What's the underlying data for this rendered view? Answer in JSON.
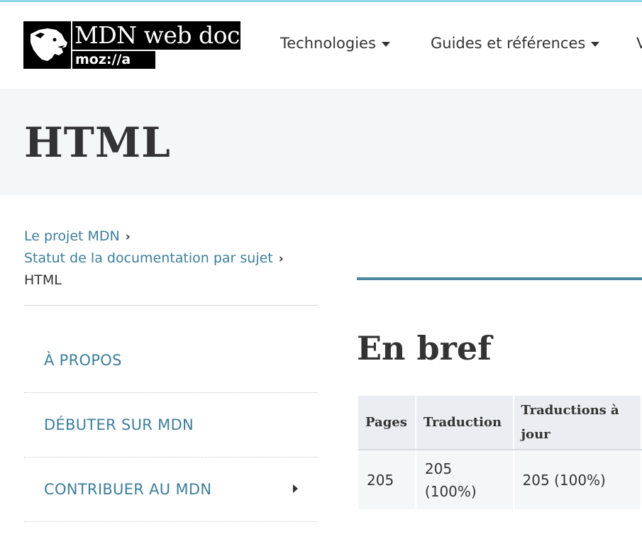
{
  "header": {
    "logo": {
      "title": "MDN web docs",
      "subtitle": "moz://a"
    },
    "nav": [
      {
        "label": "Technologies"
      },
      {
        "label": "Guides et références"
      },
      {
        "label": "V"
      }
    ]
  },
  "page": {
    "title": "HTML"
  },
  "breadcrumbs": [
    {
      "label": "Le projet MDN",
      "sep": "›"
    },
    {
      "label": "Statut de la documentation par sujet",
      "sep": "›"
    },
    {
      "label": "HTML"
    }
  ],
  "sidebar": {
    "items": [
      {
        "label": "À PROPOS"
      },
      {
        "label": "DÉBUTER SUR MDN"
      },
      {
        "label": "CONTRIBUER AU MDN"
      }
    ]
  },
  "main": {
    "section_title": "En bref",
    "table": {
      "headers": [
        "Pages",
        "Traduction",
        "Traductions à jour"
      ],
      "rows": [
        [
          "205",
          "205 (100%)",
          "205 (100%)"
        ]
      ]
    }
  },
  "colors": {
    "accent": "#3d7e9a",
    "band_bg": "#f4f7f8",
    "top_strip": "#8fd5ec"
  }
}
